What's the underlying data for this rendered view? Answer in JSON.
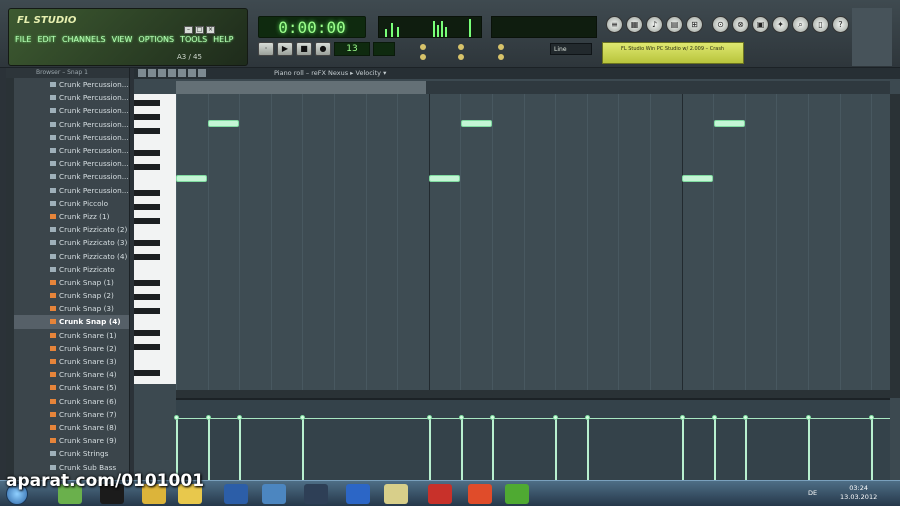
{
  "app": {
    "menu": [
      "FILE",
      "EDIT",
      "CHANNELS",
      "VIEW",
      "OPTIONS",
      "TOOLS",
      "HELP"
    ],
    "logo_text": "FL STUDIO",
    "hint": "A3 / 45"
  },
  "transport": {
    "time": "0:00:00",
    "tempo": "13",
    "snap": "Line"
  },
  "hint_bar": {
    "text": "FL Studio Win PC Studio w/ 2.009 – Crash"
  },
  "browser": {
    "header": "Browser – Snap 1",
    "items": [
      {
        "label": "Crunk Percussion...",
        "type": "plain"
      },
      {
        "label": "Crunk Percussion...",
        "type": "plain"
      },
      {
        "label": "Crunk Percussion...",
        "type": "plain"
      },
      {
        "label": "Crunk Percussion...",
        "type": "plain"
      },
      {
        "label": "Crunk Percussion...",
        "type": "plain"
      },
      {
        "label": "Crunk Percussion...",
        "type": "plain"
      },
      {
        "label": "Crunk Percussion...",
        "type": "plain"
      },
      {
        "label": "Crunk Percussion...",
        "type": "plain"
      },
      {
        "label": "Crunk Percussion...",
        "type": "plain"
      },
      {
        "label": "Crunk Piccolo",
        "type": "plain"
      },
      {
        "label": "Crunk Pizz (1)",
        "type": "orange"
      },
      {
        "label": "Crunk Pizzicato (2)",
        "type": "plain"
      },
      {
        "label": "Crunk Pizzicato (3)",
        "type": "plain"
      },
      {
        "label": "Crunk Pizzicato (4)",
        "type": "plain"
      },
      {
        "label": "Crunk Pizzicato",
        "type": "plain"
      },
      {
        "label": "Crunk Snap (1)",
        "type": "orange"
      },
      {
        "label": "Crunk Snap (2)",
        "type": "orange"
      },
      {
        "label": "Crunk Snap (3)",
        "type": "orange"
      },
      {
        "label": "Crunk Snap (4)",
        "type": "sel"
      },
      {
        "label": "Crunk Snare (1)",
        "type": "orange"
      },
      {
        "label": "Crunk Snare (2)",
        "type": "orange"
      },
      {
        "label": "Crunk Snare (3)",
        "type": "orange"
      },
      {
        "label": "Crunk Snare (4)",
        "type": "orange"
      },
      {
        "label": "Crunk Snare (5)",
        "type": "orange"
      },
      {
        "label": "Crunk Snare (6)",
        "type": "orange"
      },
      {
        "label": "Crunk Snare (7)",
        "type": "orange"
      },
      {
        "label": "Crunk Snare (8)",
        "type": "orange"
      },
      {
        "label": "Crunk Snare (9)",
        "type": "orange"
      },
      {
        "label": "Crunk Strings",
        "type": "plain"
      },
      {
        "label": "Crunk Sub Bass",
        "type": "plain"
      }
    ]
  },
  "piano_roll": {
    "title": "Piano roll – reFX Nexus ▸ Velocity ▾"
  },
  "taskbar": {
    "lang": "DE",
    "time": "03:24",
    "date": "13.03.2012"
  },
  "watermark": "aparat.com/0101001"
}
